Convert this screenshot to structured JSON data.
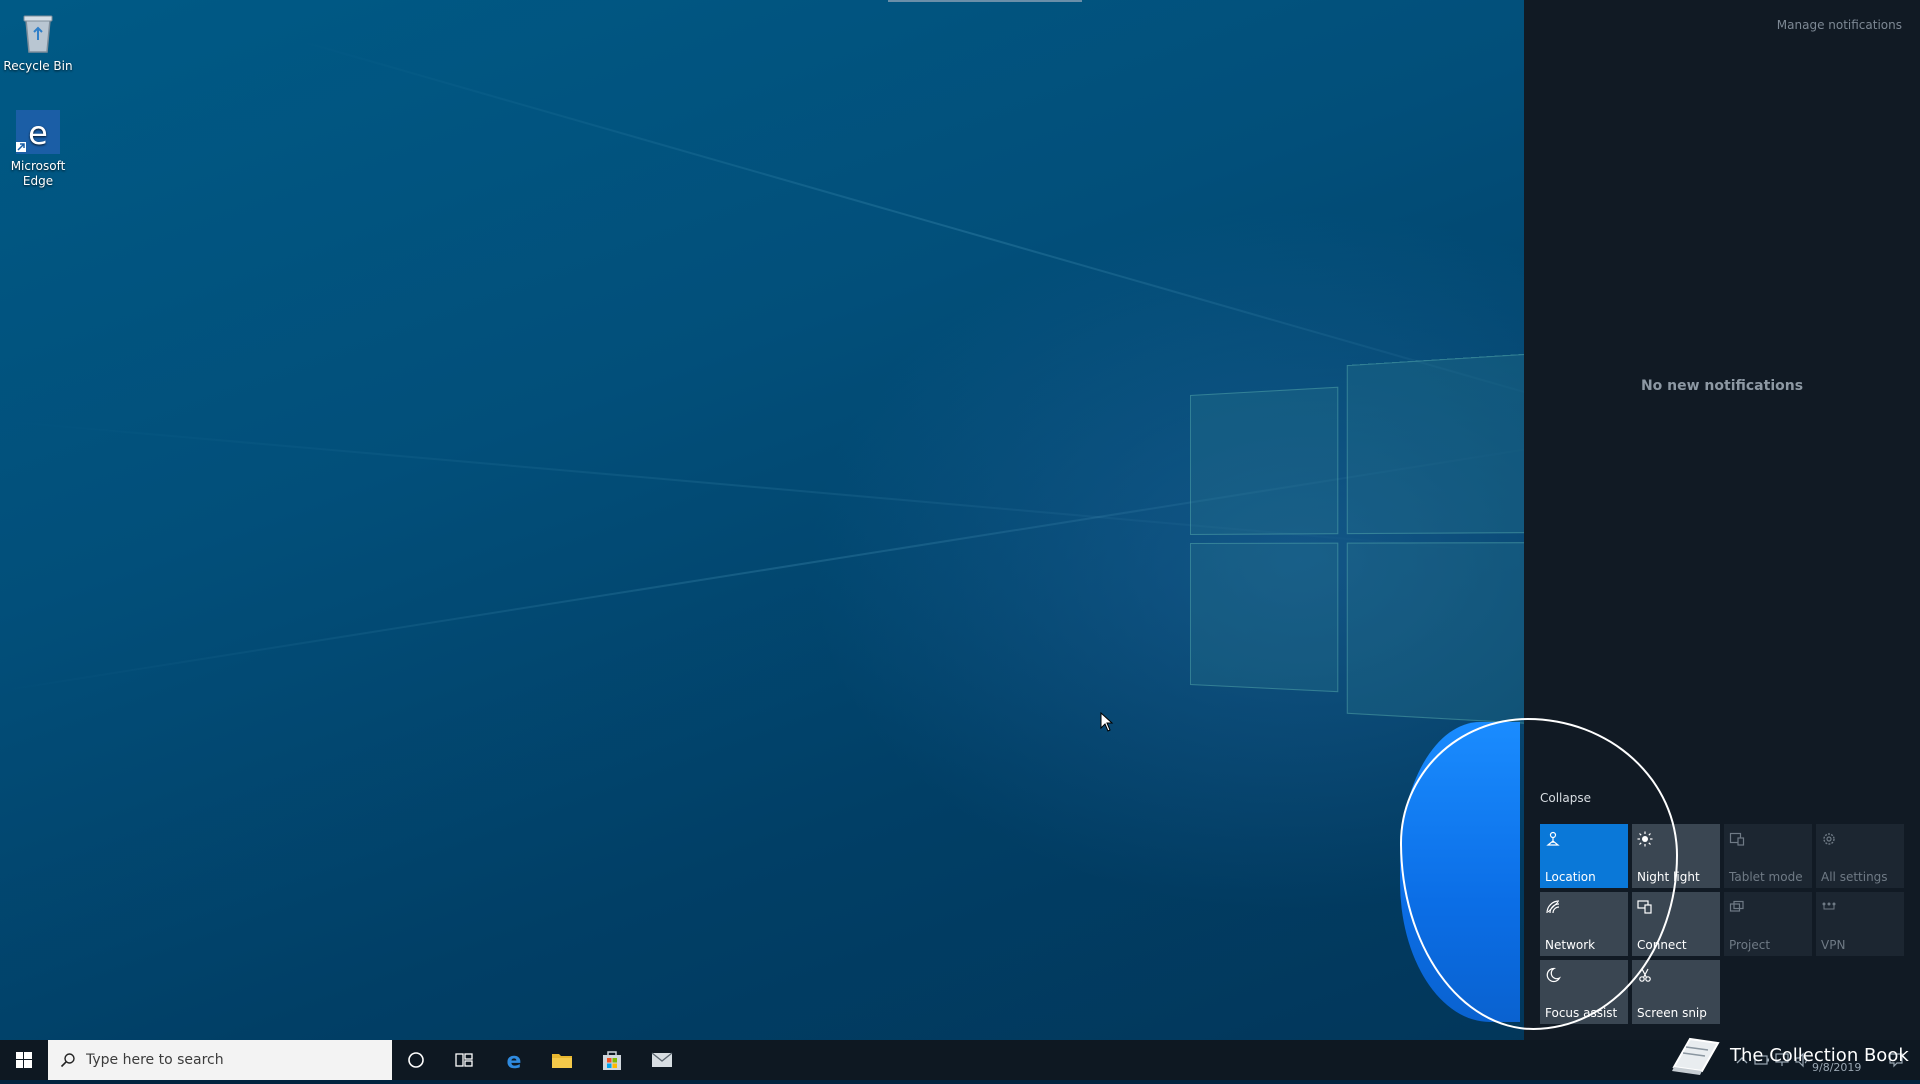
{
  "desktop": {
    "icons": [
      {
        "label": "Recycle Bin"
      },
      {
        "label": "Microsoft Edge"
      }
    ]
  },
  "action_center": {
    "manage_notifications": "Manage notifications",
    "empty_message": "No new notifications",
    "collapse_label": "Collapse",
    "tiles": [
      {
        "label": "Location",
        "icon": "location-icon",
        "state": "on"
      },
      {
        "label": "Night light",
        "icon": "brightness-icon",
        "state": "off"
      },
      {
        "label": "Tablet mode",
        "icon": "tablet-mode-icon",
        "state": "off"
      },
      {
        "label": "All settings",
        "icon": "gear-icon",
        "state": "off"
      },
      {
        "label": "Network",
        "icon": "network-icon",
        "state": "off"
      },
      {
        "label": "Connect",
        "icon": "connect-icon",
        "state": "off"
      },
      {
        "label": "Project",
        "icon": "project-icon",
        "state": "off"
      },
      {
        "label": "VPN",
        "icon": "vpn-icon",
        "state": "off"
      },
      {
        "label": "Focus assist",
        "icon": "moon-icon",
        "state": "off"
      },
      {
        "label": "Screen snip",
        "icon": "screen-snip-icon",
        "state": "off"
      }
    ],
    "accent_color": "#0a78d8"
  },
  "taskbar": {
    "search_placeholder": "Type here to search",
    "date": "9/8/2019"
  },
  "watermark": {
    "text": "The Collection Book"
  }
}
